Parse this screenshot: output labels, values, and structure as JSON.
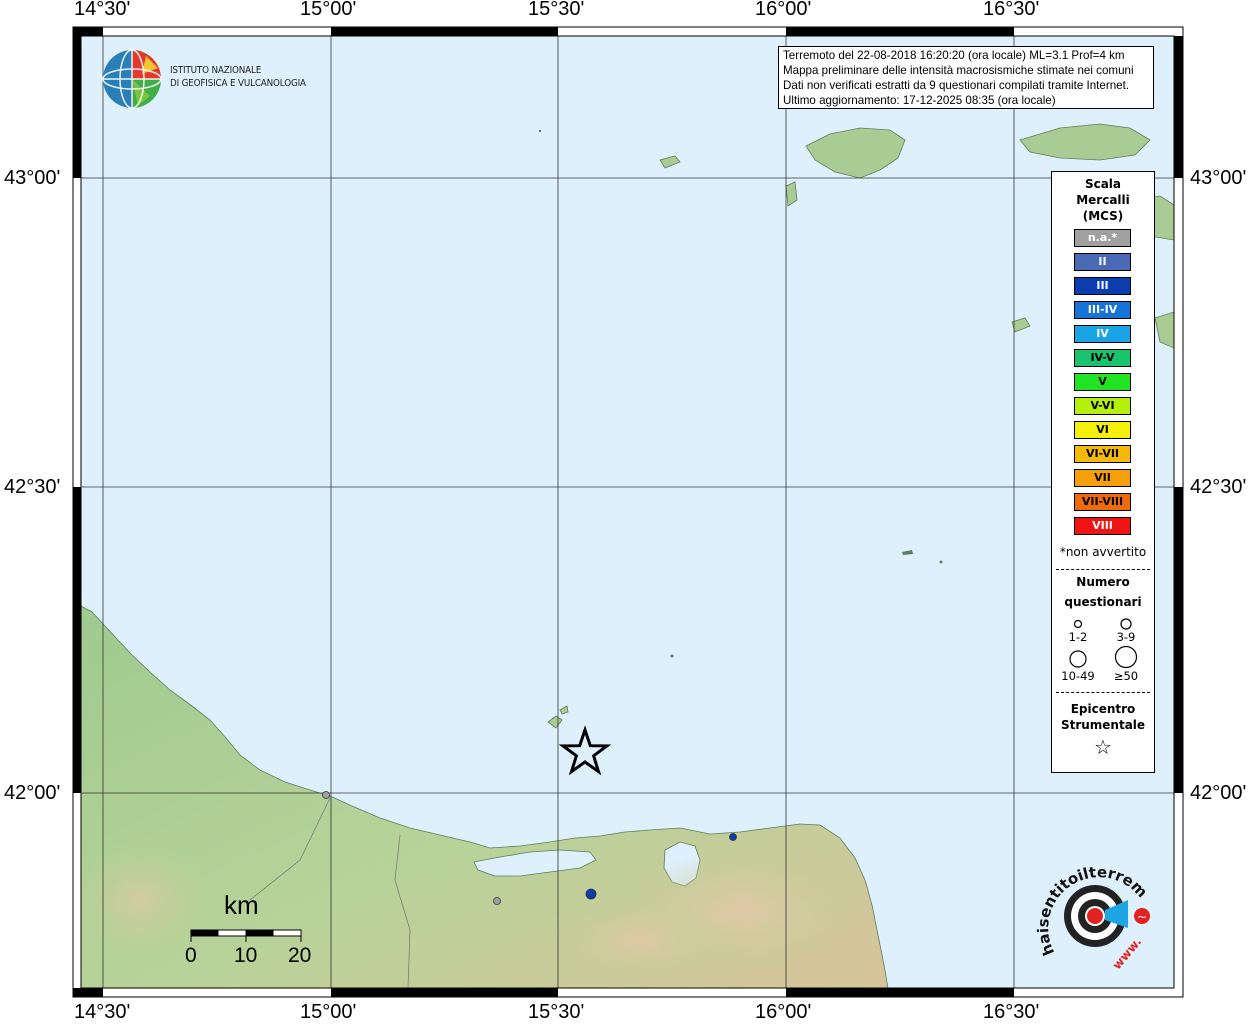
{
  "map": {
    "lon_ticks": [
      "14°30'",
      "15°00'",
      "15°30'",
      "16°00'",
      "16°30'"
    ],
    "lat_ticks": [
      "43°00'",
      "42°30'",
      "42°00'"
    ],
    "colors": {
      "sea": "#dff0fd",
      "land": "#a9cc94",
      "frame": "#000000"
    }
  },
  "info": {
    "line1": "Terremoto del 22-08-2018 16:20:20 (ora locale) ML=3.1 Prof=4 km",
    "line2": "Mappa preliminare delle intensità macrosismiche stimate nei comuni",
    "line3": "Dati non verificati estratti da 9 questionari compilati tramite Internet.",
    "line4": "Ultimo aggiornamento: 17-12-2025 08:35 (ora locale)"
  },
  "logo": {
    "line1": "ISTITUTO NAZIONALE",
    "line2": "DI GEOFISICA E VULCANOLOGIA"
  },
  "legend": {
    "title1": "Scala",
    "title2": "Mercalli",
    "title3": "(MCS)",
    "scale": [
      {
        "label": "n.a.*",
        "color": "#a0a0a0",
        "text": "#ffffff"
      },
      {
        "label": "II",
        "color": "#4a6ab5",
        "text": "#ffffff"
      },
      {
        "label": "III",
        "color": "#0b3cb0",
        "text": "#ffffff"
      },
      {
        "label": "III-IV",
        "color": "#1873d6",
        "text": "#ffffff"
      },
      {
        "label": "IV",
        "color": "#1aa4e6",
        "text": "#ffffff"
      },
      {
        "label": "IV-V",
        "color": "#1ac46e",
        "text": "#000000"
      },
      {
        "label": "V",
        "color": "#22e322",
        "text": "#000000"
      },
      {
        "label": "V-VI",
        "color": "#b4f00a",
        "text": "#000000"
      },
      {
        "label": "VI",
        "color": "#f5f00a",
        "text": "#000000"
      },
      {
        "label": "VI-VII",
        "color": "#f5b90a",
        "text": "#000000"
      },
      {
        "label": "VII",
        "color": "#f5a00a",
        "text": "#000000"
      },
      {
        "label": "VII-VIII",
        "color": "#f06a0a",
        "text": "#000000"
      },
      {
        "label": "VIII",
        "color": "#f01414",
        "text": "#ffffff"
      }
    ],
    "note": "*non avvertito",
    "count_title1": "Numero",
    "count_title2": "questionari",
    "sizes": [
      "1-2",
      "3-9",
      "10-49",
      "≥50"
    ],
    "epi_title1": "Epicentro",
    "epi_title2": "Strumentale",
    "epi_symbol": "☆"
  },
  "scalebar": {
    "unit": "km",
    "labels": [
      "0",
      "10",
      "20"
    ]
  },
  "points": [
    {
      "name": "point-gray-north",
      "intensity": "n.a.*"
    },
    {
      "name": "point-gray-south",
      "intensity": "n.a.*"
    },
    {
      "name": "point-blue-east",
      "intensity": "III"
    },
    {
      "name": "point-blue-center",
      "intensity": "III"
    }
  ],
  "brand": {
    "logo_text": "haisentitoilterremoto.it",
    "prefix": "www."
  }
}
